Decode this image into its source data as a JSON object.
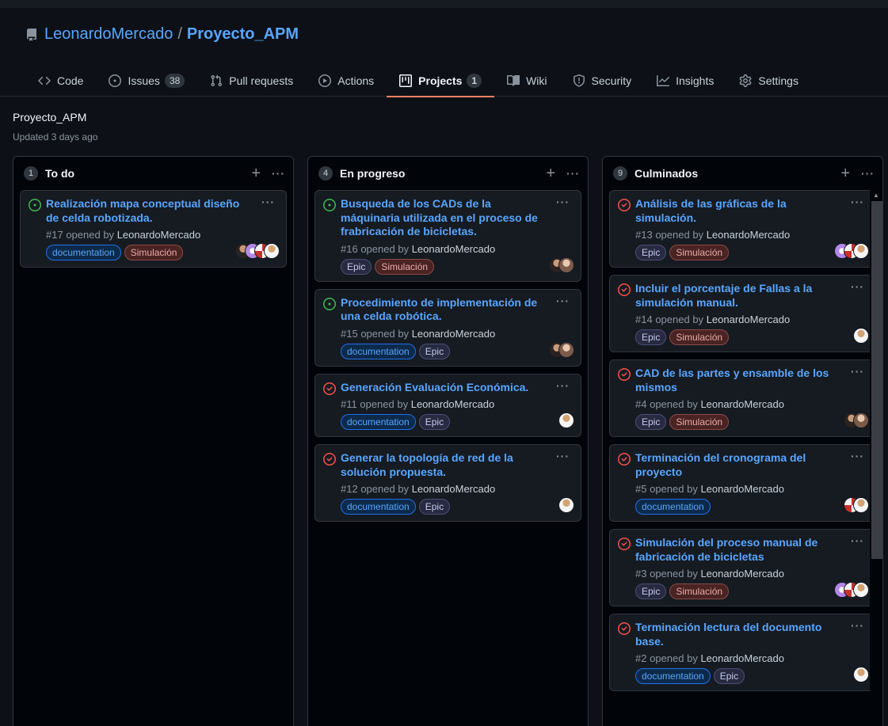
{
  "repo": {
    "owner": "LeonardoMercado",
    "separator": "/",
    "name": "Proyecto_APM"
  },
  "tabs": [
    {
      "label": "Code",
      "icon": "code-icon"
    },
    {
      "label": "Issues",
      "count": "38",
      "icon": "issue-opened-icon"
    },
    {
      "label": "Pull requests",
      "icon": "git-pull-request-icon"
    },
    {
      "label": "Actions",
      "icon": "play-icon"
    },
    {
      "label": "Projects",
      "count": "1",
      "icon": "project-icon",
      "active": true
    },
    {
      "label": "Wiki",
      "icon": "book-icon"
    },
    {
      "label": "Security",
      "icon": "shield-icon"
    },
    {
      "label": "Insights",
      "icon": "graph-icon"
    },
    {
      "label": "Settings",
      "icon": "gear-icon"
    }
  ],
  "project": {
    "name": "Proyecto_APM",
    "updated": "Updated 3 days ago"
  },
  "colors": {
    "accent": "#58a6ff",
    "tab_underline": "#f78166",
    "open": "#3fb950",
    "closed": "#f85149"
  },
  "columns": [
    {
      "count": "1",
      "title": "To do",
      "cards": [
        {
          "status": "open",
          "title": "Realización mapa conceptual diseño de celda robotizada.",
          "number": "#17",
          "opened_by": "opened by",
          "author": "LeonardoMercado",
          "labels": [
            {
              "text": "documentation",
              "kind": "doc"
            },
            {
              "text": "Simulación",
              "kind": "sim"
            }
          ],
          "avatars": [
            "a",
            "d",
            "c",
            "e"
          ]
        }
      ]
    },
    {
      "count": "4",
      "title": "En progreso",
      "cards": [
        {
          "status": "open",
          "title": "Busqueda de los CADs de la máquinaria utilizada en el proceso de frabricación de bicicletas.",
          "number": "#16",
          "opened_by": "opened by",
          "author": "LeonardoMercado",
          "labels": [
            {
              "text": "Epic",
              "kind": "epic"
            },
            {
              "text": "Simulación",
              "kind": "sim"
            }
          ],
          "avatars": [
            "a",
            "b"
          ]
        },
        {
          "status": "open",
          "title": "Procedimiento de implementación de una celda robótica.",
          "number": "#15",
          "opened_by": "opened by",
          "author": "LeonardoMercado",
          "labels": [
            {
              "text": "documentation",
              "kind": "doc"
            },
            {
              "text": "Epic",
              "kind": "epic"
            }
          ],
          "avatars": [
            "a",
            "b"
          ]
        },
        {
          "status": "closed",
          "title": "Generación Evaluación Económica.",
          "number": "#11",
          "opened_by": "opened by",
          "author": "LeonardoMercado",
          "labels": [
            {
              "text": "documentation",
              "kind": "doc"
            },
            {
              "text": "Epic",
              "kind": "epic"
            }
          ],
          "avatars": [
            "e"
          ]
        },
        {
          "status": "closed",
          "title": "Generar la topología de red de la solución propuesta.",
          "number": "#12",
          "opened_by": "opened by",
          "author": "LeonardoMercado",
          "labels": [
            {
              "text": "documentation",
              "kind": "doc"
            },
            {
              "text": "Epic",
              "kind": "epic"
            }
          ],
          "avatars": [
            "e"
          ]
        }
      ]
    },
    {
      "count": "9",
      "title": "Culminados",
      "cards": [
        {
          "status": "closed",
          "title": "Análisis de las gráficas de la simulación.",
          "number": "#13",
          "opened_by": "opened by",
          "author": "LeonardoMercado",
          "labels": [
            {
              "text": "Epic",
              "kind": "epic"
            },
            {
              "text": "Simulación",
              "kind": "sim"
            }
          ],
          "avatars": [
            "d",
            "c",
            "e"
          ]
        },
        {
          "status": "closed",
          "title": "Incluir el porcentaje de Fallas a la simulación manual.",
          "number": "#14",
          "opened_by": "opened by",
          "author": "LeonardoMercado",
          "labels": [
            {
              "text": "Epic",
              "kind": "epic"
            },
            {
              "text": "Simulación",
              "kind": "sim"
            }
          ],
          "avatars": [
            "e"
          ]
        },
        {
          "status": "closed",
          "title": "CAD de las partes y ensamble de los mismos",
          "number": "#4",
          "opened_by": "opened by",
          "author": "LeonardoMercado",
          "labels": [
            {
              "text": "Epic",
              "kind": "epic"
            },
            {
              "text": "Simulación",
              "kind": "sim"
            }
          ],
          "avatars": [
            "a",
            "b"
          ]
        },
        {
          "status": "closed",
          "title": "Terminación del cronograma del proyecto",
          "number": "#5",
          "opened_by": "opened by",
          "author": "LeonardoMercado",
          "labels": [
            {
              "text": "documentation",
              "kind": "doc"
            }
          ],
          "avatars": [
            "c",
            "e"
          ]
        },
        {
          "status": "closed",
          "title": "Simulación del proceso manual de fabricación de bicicletas",
          "number": "#3",
          "opened_by": "opened by",
          "author": "LeonardoMercado",
          "labels": [
            {
              "text": "Epic",
              "kind": "epic"
            },
            {
              "text": "Simulación",
              "kind": "sim"
            }
          ],
          "avatars": [
            "d",
            "c",
            "e"
          ]
        },
        {
          "status": "closed",
          "title": "Terminación lectura del documento base.",
          "number": "#2",
          "opened_by": "opened by",
          "author": "LeonardoMercado",
          "labels": [
            {
              "text": "documentation",
              "kind": "doc"
            },
            {
              "text": "Epic",
              "kind": "epic"
            }
          ],
          "avatars": [
            "e"
          ]
        }
      ]
    }
  ],
  "add_symbol": "+",
  "more_symbol": "···"
}
